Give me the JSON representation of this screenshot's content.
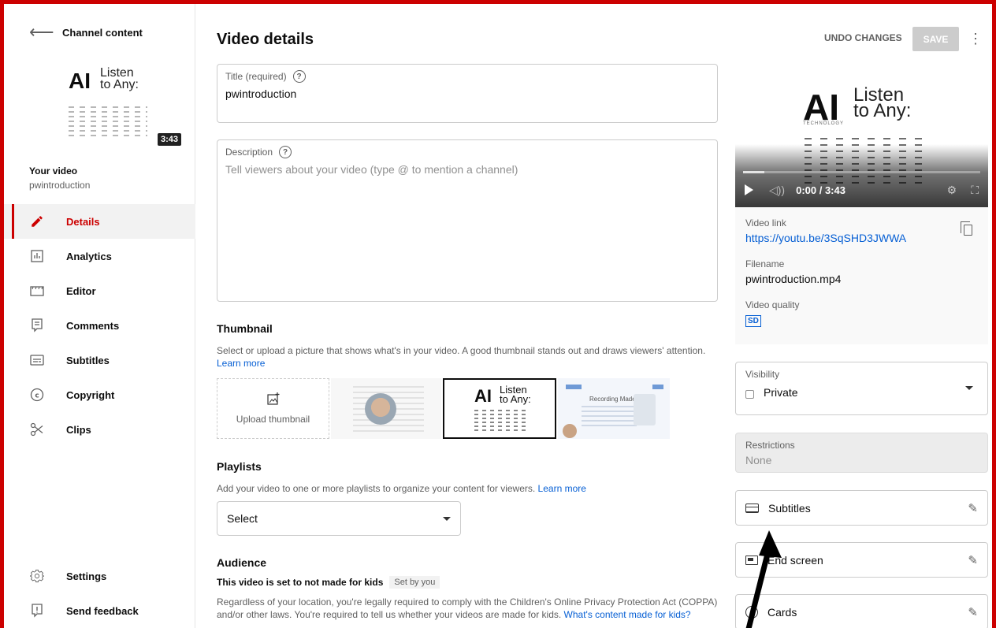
{
  "sidebar": {
    "title": "Channel content",
    "thumb": {
      "logo": "AI",
      "logo_sub_1": "Listen",
      "logo_sub_2": "to Any:",
      "duration": "3:43"
    },
    "your_video": "Your video",
    "video_name": "pwintroduction",
    "items": [
      {
        "label": "Details",
        "icon": "pencil-icon",
        "active": true
      },
      {
        "label": "Analytics",
        "icon": "analytics-icon"
      },
      {
        "label": "Editor",
        "icon": "editor-icon"
      },
      {
        "label": "Comments",
        "icon": "comments-icon"
      },
      {
        "label": "Subtitles",
        "icon": "subtitles-icon"
      },
      {
        "label": "Copyright",
        "icon": "copyright-icon"
      },
      {
        "label": "Clips",
        "icon": "scissors-icon"
      }
    ],
    "bottom": [
      {
        "label": "Settings",
        "icon": "gear-icon"
      },
      {
        "label": "Send feedback",
        "icon": "feedback-icon"
      }
    ]
  },
  "header": {
    "title": "Video details",
    "undo": "UNDO CHANGES",
    "save": "SAVE"
  },
  "title_field": {
    "label": "Title (required)",
    "value": "pwintroduction"
  },
  "description_field": {
    "label": "Description",
    "placeholder": "Tell viewers about your video (type @ to mention a channel)"
  },
  "thumbnail": {
    "title": "Thumbnail",
    "text": "Select or upload a picture that shows what's in your video. A good thumbnail stands out and draws viewers' attention.",
    "learn_more": "Learn more",
    "upload": "Upload thumbnail",
    "option_2": {
      "logo": "AI",
      "logo_sub_1": "Listen",
      "logo_sub_2": "to Any:"
    },
    "option_3": {
      "text": "Recording Made Easy"
    }
  },
  "playlists": {
    "title": "Playlists",
    "text": "Add your video to one or more playlists to organize your content for viewers.",
    "learn_more": "Learn more",
    "select": "Select"
  },
  "audience": {
    "title": "Audience",
    "kids": "This video is set to not made for kids",
    "badge": "Set by you",
    "text": "Regardless of your location, you're legally required to comply with the Children's Online Privacy Protection Act (COPPA) and/or other laws. You're required to tell us whether your videos are made for kids.",
    "link": "What's content made for kids?"
  },
  "preview": {
    "logo": "AI",
    "logo_sub_1": "Listen",
    "logo_sub_2": "to Any:",
    "tech": "TECHNOLOGY",
    "time": "0:00 / 3:43",
    "progress": 0.09
  },
  "info": {
    "link_label": "Video link",
    "link": "https://youtu.be/3SqSHD3JWWA",
    "filename_label": "Filename",
    "filename": "pwintroduction.mp4",
    "quality_label": "Video quality",
    "quality": "SD"
  },
  "visibility": {
    "label": "Visibility",
    "value": "Private"
  },
  "restrictions": {
    "label": "Restrictions",
    "value": "None"
  },
  "options": {
    "subtitles": "Subtitles",
    "end_screen": "End screen",
    "cards": "Cards"
  },
  "colors": {
    "accent": "#cc0000",
    "link": "#065fd4",
    "save_disabled": "#cccccc"
  }
}
